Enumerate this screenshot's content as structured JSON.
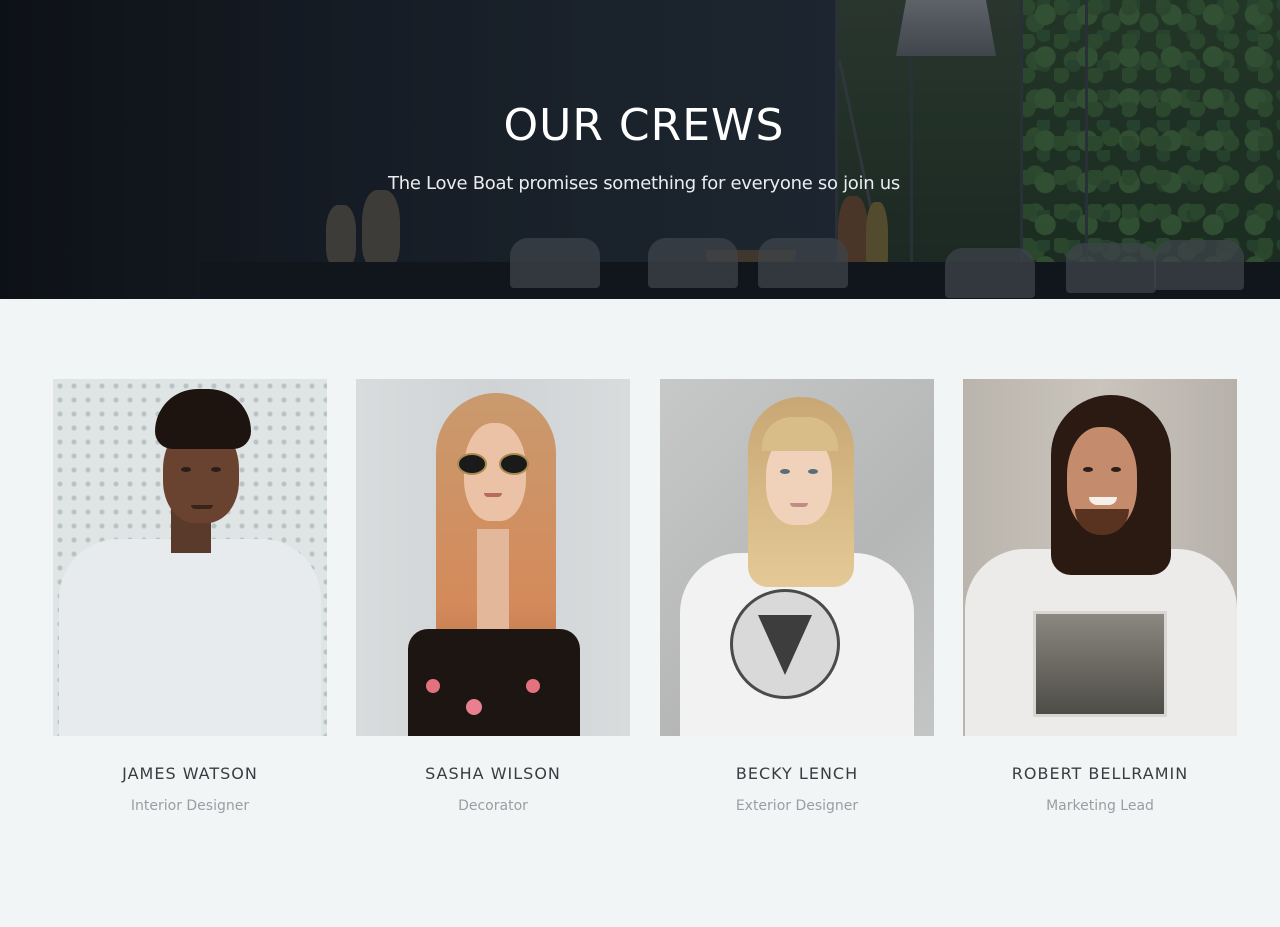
{
  "hero": {
    "title": "OUR CREWS",
    "subtitle": "The Love Boat promises something for everyone so join us"
  },
  "crew": [
    {
      "name": "JAMES WATSON",
      "role": "Interior Designer"
    },
    {
      "name": "SASHA WILSON",
      "role": "Decorator"
    },
    {
      "name": "BECKY LENCH",
      "role": "Exterior Designer"
    },
    {
      "name": "ROBERT BELLRAMIN",
      "role": "Marketing Lead"
    }
  ],
  "colors": {
    "page_background": "#f2f5f6",
    "name_text": "#3a3d40",
    "role_text": "#9a9ea2",
    "hero_text": "#ffffff"
  }
}
